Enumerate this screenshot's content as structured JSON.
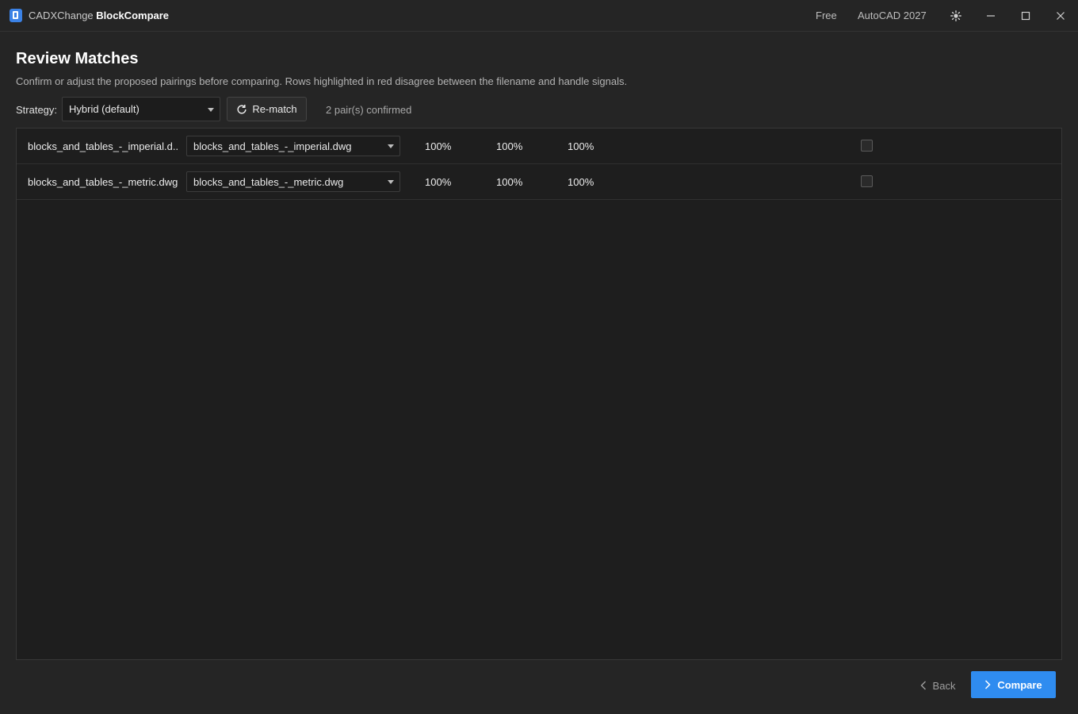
{
  "titlebar": {
    "app_name": "CADXChange",
    "app_product": "BlockCompare",
    "plan": "Free",
    "cad_version": "AutoCAD 2027",
    "icons": [
      "theme-icon",
      "minimize-icon",
      "maximize-icon",
      "close-icon"
    ]
  },
  "header": {
    "title": "Review Matches",
    "subtitle": "Confirm or adjust the proposed pairings before comparing. Rows highlighted in red disagree between the filename and handle signals."
  },
  "toolbar": {
    "strategy_label": "Strategy:",
    "strategy_value": "Hybrid (default)",
    "rematch_label": "Re-match",
    "confirmed_text": "2 pair(s) confirmed"
  },
  "rows": [
    {
      "source": "blocks_and_tables_-_imperial.d...",
      "target": "blocks_and_tables_-_imperial.dwg",
      "score1": "100%",
      "score2": "100%",
      "score3": "100%",
      "checked": false
    },
    {
      "source": "blocks_and_tables_-_metric.dwg",
      "target": "blocks_and_tables_-_metric.dwg",
      "score1": "100%",
      "score2": "100%",
      "score3": "100%",
      "checked": false
    }
  ],
  "footer": {
    "back_label": "Back",
    "compare_label": "Compare"
  },
  "colors": {
    "background": "#252525",
    "accent": "#2f8cf0",
    "table_bg": "#1e1e1e"
  }
}
